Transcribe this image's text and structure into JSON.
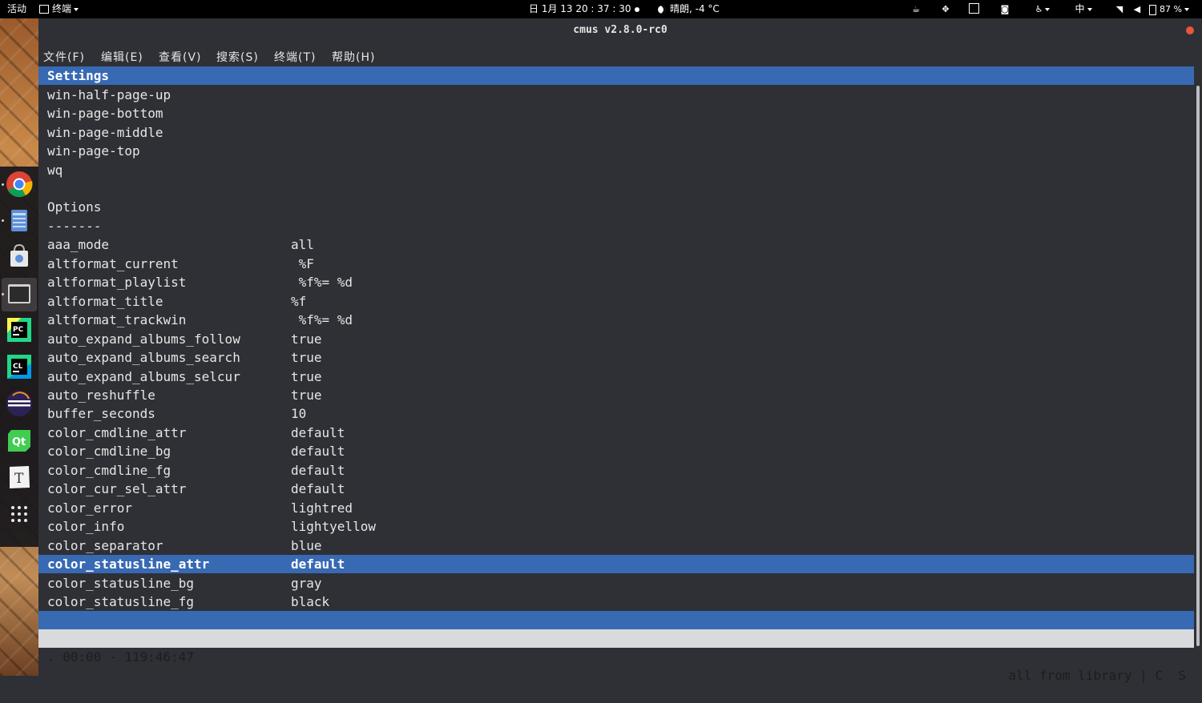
{
  "topbar": {
    "activities": "活动",
    "app_menu": "终端",
    "clock": "日 1月 13  20 : 37 : 30",
    "weather": "晴朗, -4 °C",
    "input_method": "中",
    "battery": "87 %"
  },
  "window": {
    "title": "cmus v2.8.0-rc0",
    "menus": [
      "文件(F)",
      "编辑(E)",
      "查看(V)",
      "搜索(S)",
      "终端(T)",
      "帮助(H)"
    ]
  },
  "terminal": {
    "header": "Settings",
    "commands": [
      "win-half-page-up",
      "win-page-bottom",
      "win-page-middle",
      "win-page-top",
      "wq"
    ],
    "options_title": "Options",
    "options_rule": "-------",
    "options": [
      {
        "name": "aaa_mode",
        "value": "all"
      },
      {
        "name": "altformat_current",
        "value": " %F"
      },
      {
        "name": "altformat_playlist",
        "value": " %f%= %d"
      },
      {
        "name": "altformat_title",
        "value": "%f"
      },
      {
        "name": "altformat_trackwin",
        "value": " %f%= %d"
      },
      {
        "name": "auto_expand_albums_follow",
        "value": "true"
      },
      {
        "name": "auto_expand_albums_search",
        "value": "true"
      },
      {
        "name": "auto_expand_albums_selcur",
        "value": "true"
      },
      {
        "name": "auto_reshuffle",
        "value": "true"
      },
      {
        "name": "buffer_seconds",
        "value": "10"
      },
      {
        "name": "color_cmdline_attr",
        "value": "default"
      },
      {
        "name": "color_cmdline_bg",
        "value": "default"
      },
      {
        "name": "color_cmdline_fg",
        "value": "default"
      },
      {
        "name": "color_cur_sel_attr",
        "value": "default"
      },
      {
        "name": "color_error",
        "value": "lightred"
      },
      {
        "name": "color_info",
        "value": "lightyellow"
      },
      {
        "name": "color_separator",
        "value": "blue"
      },
      {
        "name": "color_statusline_attr",
        "value": "default"
      },
      {
        "name": "color_statusline_bg",
        "value": "gray"
      },
      {
        "name": "color_statusline_fg",
        "value": "black"
      }
    ],
    "selected_option": "color_statusline_attr",
    "status_left": ". 00:00 - 119:46:47",
    "status_right": "all from library | C  S"
  },
  "colors": {
    "highlight": "#3869b3",
    "terminal_bg": "#2e3035",
    "statusline_bg": "#d9dadb"
  },
  "dock": {
    "apps": [
      "chrome-icon",
      "files-icon",
      "software-store-icon",
      "terminal-icon",
      "pycharm-icon",
      "clion-icon",
      "eclipse-icon",
      "qt-creator-icon",
      "typora-icon",
      "app-grid-icon"
    ]
  }
}
